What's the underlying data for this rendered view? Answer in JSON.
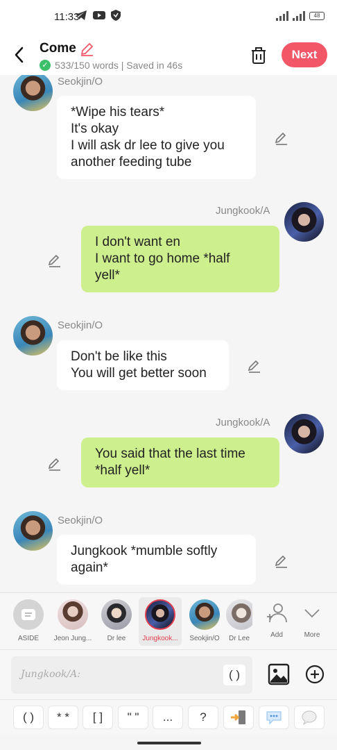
{
  "status_bar": {
    "time": "11:33",
    "battery": "48"
  },
  "header": {
    "title": "Come",
    "subtitle": "533/150 words | Saved in 46s",
    "next_label": "Next"
  },
  "messages": [
    {
      "sender": "Seokjin/O",
      "side": "left",
      "text": [
        "*Wipe his tears*",
        "It's okay",
        "I will ask dr lee to give you",
        "another feeding tube"
      ]
    },
    {
      "sender": "Jungkook/A",
      "side": "right",
      "text": [
        "I don't want en",
        "I want to go home *half",
        "yell*"
      ]
    },
    {
      "sender": "Seokjin/O",
      "side": "left",
      "text": [
        "Don't be like this",
        "You will get better soon"
      ]
    },
    {
      "sender": "Jungkook/A",
      "side": "right",
      "text": [
        "You said that the last time",
        "*half yell*"
      ]
    },
    {
      "sender": "Seokjin/O",
      "side": "left",
      "text": [
        "Jungkook *mumble softly",
        "again*"
      ]
    }
  ],
  "characters": [
    {
      "label": "ASIDE"
    },
    {
      "label": "Jeon Jung..."
    },
    {
      "label": "Dr lee"
    },
    {
      "label": "Jungkook...",
      "selected": true
    },
    {
      "label": "Seokjin/O"
    },
    {
      "label": "Dr Lee"
    }
  ],
  "char_actions": {
    "add": "Add",
    "more": "More"
  },
  "input": {
    "placeholder": "Jungkook/A:",
    "paren_button": "( )"
  },
  "format_buttons": [
    "( )",
    "* *",
    "[ ]",
    "\" \"",
    "...",
    "?",
    "exit-icon",
    "chat-bubble-icon",
    "speech-bubble-icon"
  ]
}
